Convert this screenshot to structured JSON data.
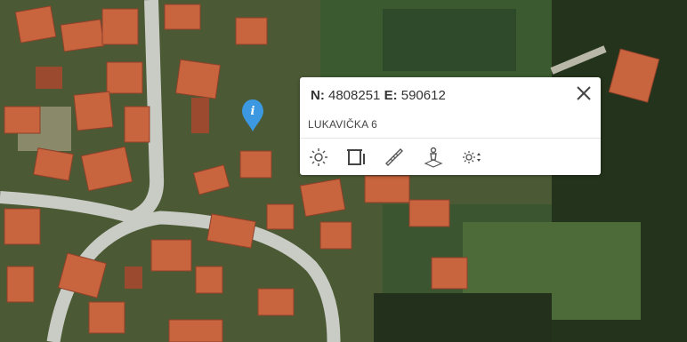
{
  "map": {
    "colors": {
      "grass": "#4b5a34",
      "dark_vegetation": "#24331c",
      "field": "#2f4a2a",
      "road": "#c9cbc5",
      "roof": "#c8643e",
      "roof_dark": "#9b4a2f",
      "marker": "#3c98e0"
    },
    "marker": {
      "icon": "info-marker-icon",
      "glyph": "i"
    }
  },
  "popup": {
    "coords": {
      "n_label": "N:",
      "n_value": "4808251",
      "e_label": "E:",
      "e_value": "590612"
    },
    "address": "LUKAVIČKA 6",
    "close_icon": "close-icon",
    "tools": [
      {
        "name": "sun-icon"
      },
      {
        "name": "window-height-icon"
      },
      {
        "name": "ruler-icon"
      },
      {
        "name": "person-location-icon"
      },
      {
        "name": "sun-adjust-icon"
      }
    ]
  }
}
